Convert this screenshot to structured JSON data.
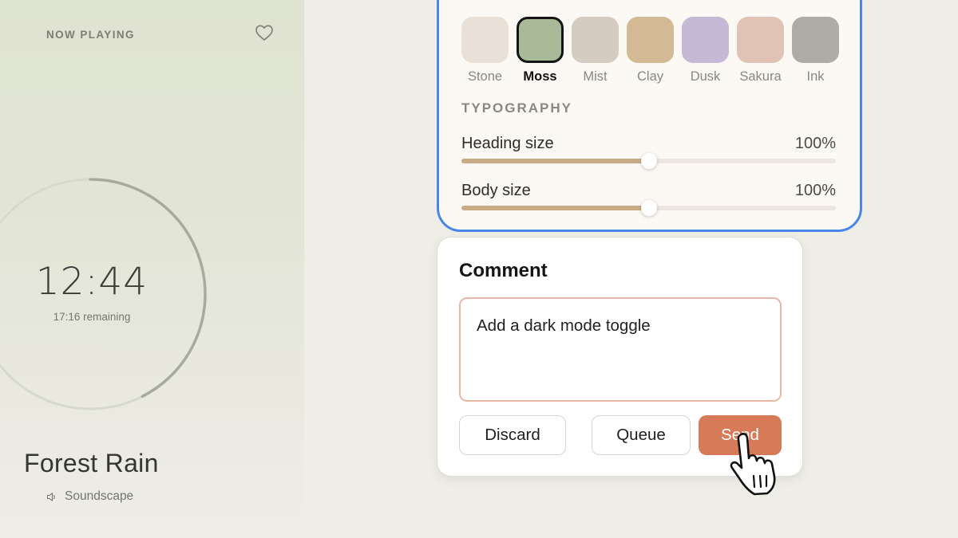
{
  "player": {
    "now_playing_label": "NOW PLAYING",
    "heart_icon": "heart-outline-icon",
    "time": "12:44",
    "remaining": "17:16 remaining",
    "track_title": "Forest Rain",
    "track_type": "Soundscape",
    "track_type_icon": "speaker-icon",
    "progress": 0.425
  },
  "appearance": {
    "swatches": [
      {
        "label": "Stone",
        "color": "#e9e1d8",
        "selected": false
      },
      {
        "label": "Moss",
        "color": "#a8ba98",
        "selected": true
      },
      {
        "label": "Mist",
        "color": "#d4ccc1",
        "selected": false
      },
      {
        "label": "Clay",
        "color": "#d4b995",
        "selected": false
      },
      {
        "label": "Dusk",
        "color": "#c4bad5",
        "selected": false
      },
      {
        "label": "Sakura",
        "color": "#e1c3b6",
        "selected": false
      },
      {
        "label": "Ink",
        "color": "#aeaca7",
        "selected": false
      }
    ],
    "typography_heading": "TYPOGRAPHY",
    "heading_size": {
      "label": "Heading size",
      "value": "100%",
      "fraction": 0.5
    },
    "body_size": {
      "label": "Body size",
      "value": "100%",
      "fraction": 0.5
    }
  },
  "comment": {
    "title": "Comment",
    "text": "Add a dark mode toggle",
    "discard_label": "Discard",
    "queue_label": "Queue",
    "send_label": "Send"
  },
  "colors": {
    "accent_blue": "#4a86e8",
    "send_button": "#d77a58",
    "slider_fill": "#c8ac86"
  }
}
